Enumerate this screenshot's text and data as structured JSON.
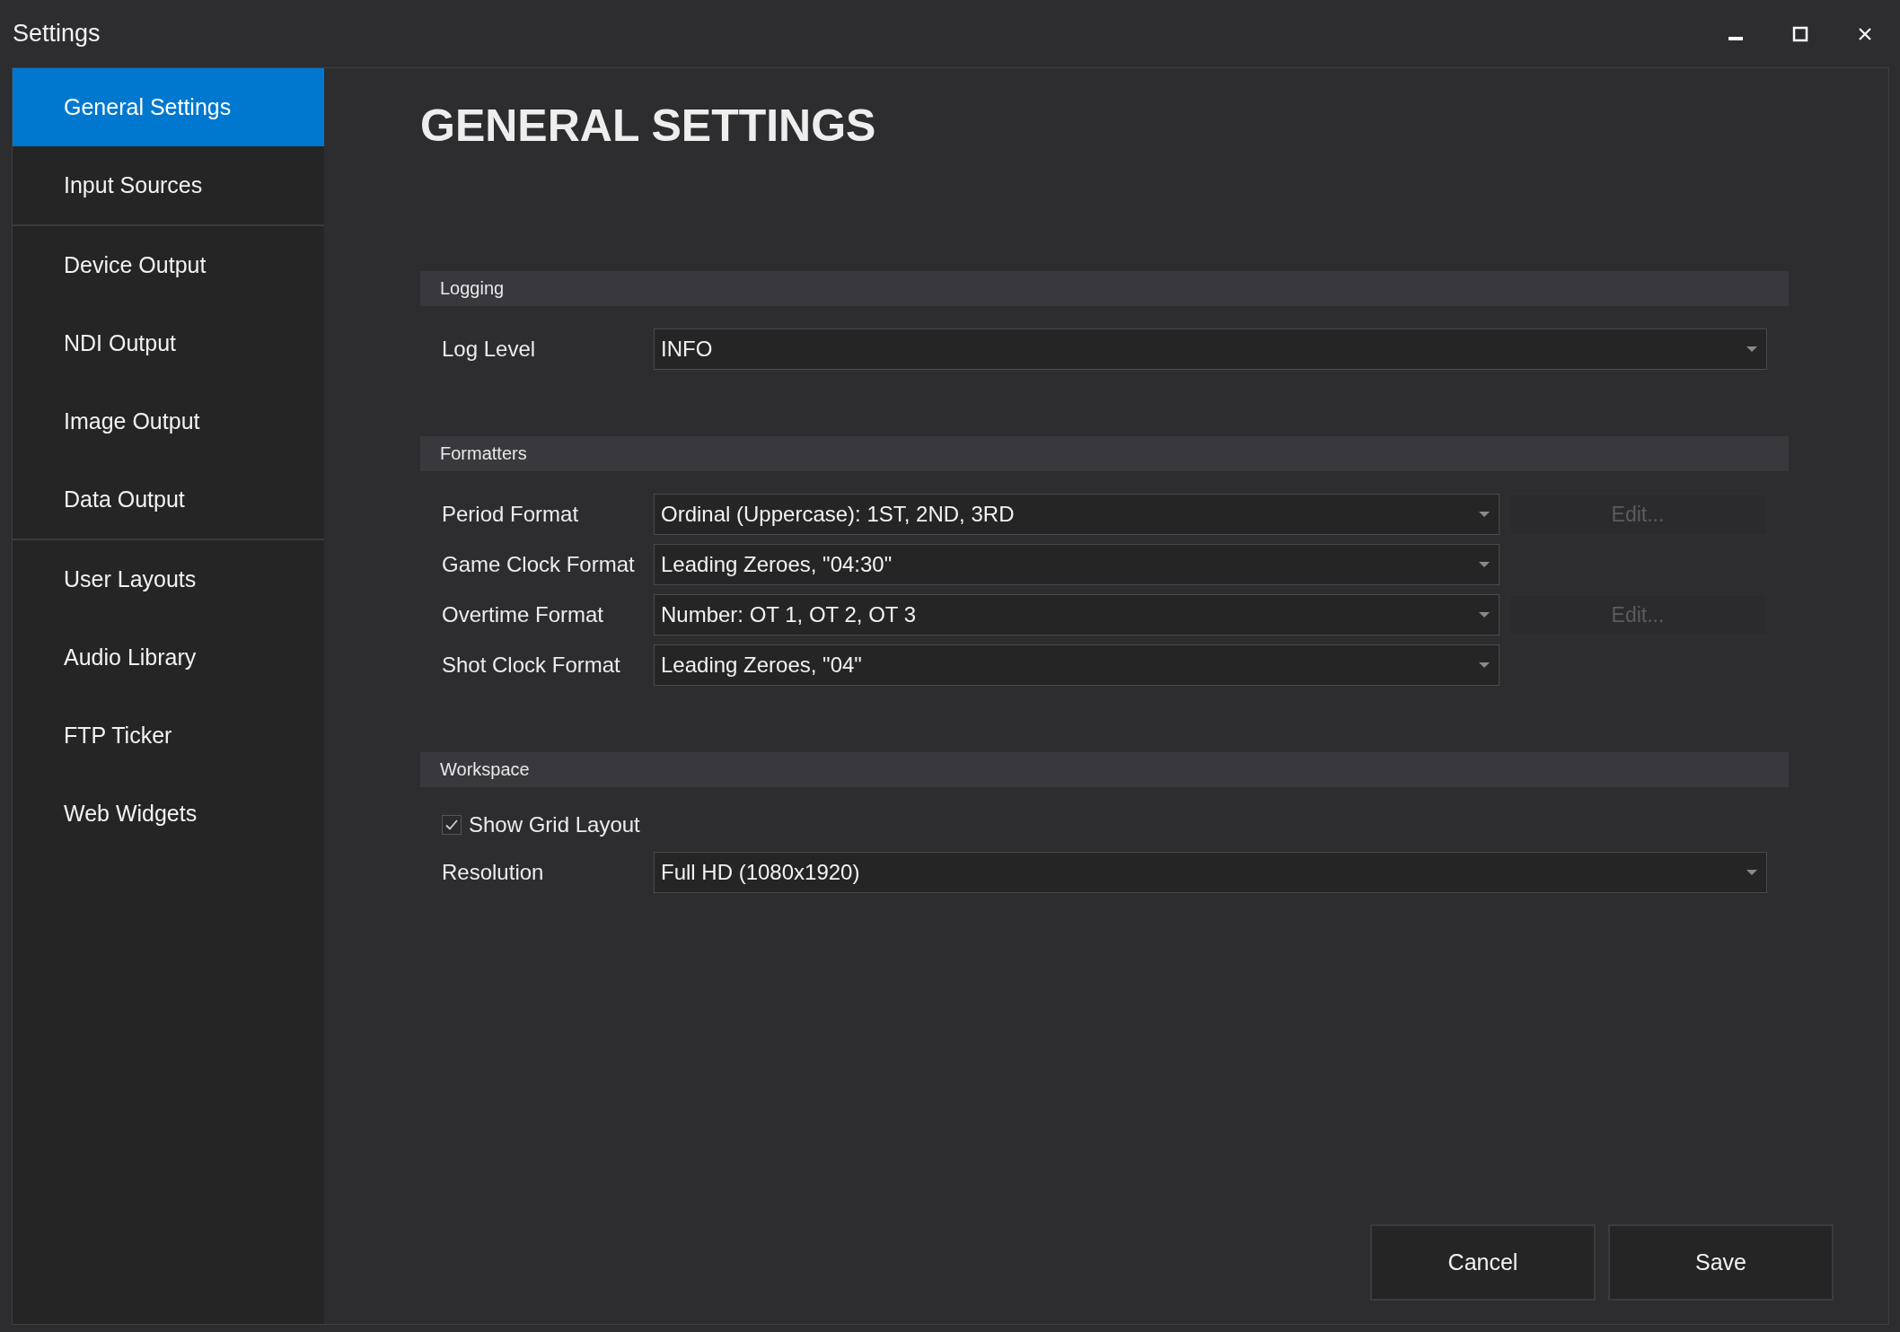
{
  "window": {
    "title": "Settings"
  },
  "sidebar": {
    "groups": [
      [
        {
          "label": "General Settings",
          "selected": true
        },
        {
          "label": "Input Sources",
          "selected": false
        }
      ],
      [
        {
          "label": "Device Output",
          "selected": false
        },
        {
          "label": "NDI Output",
          "selected": false
        },
        {
          "label": "Image Output",
          "selected": false
        },
        {
          "label": "Data Output",
          "selected": false
        }
      ],
      [
        {
          "label": "User Layouts",
          "selected": false
        },
        {
          "label": "Audio Library",
          "selected": false
        },
        {
          "label": "FTP Ticker",
          "selected": false
        },
        {
          "label": "Web Widgets",
          "selected": false
        }
      ]
    ]
  },
  "page": {
    "heading": "GENERAL SETTINGS",
    "sections": [
      {
        "title": "Logging",
        "rows": [
          {
            "kind": "dropdown",
            "label": "Log Level",
            "value": "INFO"
          }
        ]
      },
      {
        "title": "Formatters",
        "rows": [
          {
            "kind": "dropdown",
            "label": "Period Format",
            "value": "Ordinal (Uppercase): 1ST, 2ND, 3RD",
            "edit_button": {
              "label": "Edit...",
              "disabled": true
            }
          },
          {
            "kind": "dropdown",
            "label": "Game Clock Format",
            "value": "Leading Zeroes, \"04:30\"",
            "narrow": true
          },
          {
            "kind": "dropdown",
            "label": "Overtime Format",
            "value": "Number: OT 1, OT 2, OT 3",
            "edit_button": {
              "label": "Edit...",
              "disabled": true
            }
          },
          {
            "kind": "dropdown",
            "label": "Shot Clock Format",
            "value": "Leading Zeroes, \"04\"",
            "narrow": true
          }
        ]
      },
      {
        "title": "Workspace",
        "rows": [
          {
            "kind": "checkbox",
            "label": "Show Grid Layout",
            "checked": true
          },
          {
            "kind": "dropdown",
            "label": "Resolution",
            "value": "Full HD (1080x1920)"
          }
        ]
      }
    ]
  },
  "buttons": [
    {
      "label": "Cancel"
    },
    {
      "label": "Save"
    }
  ]
}
